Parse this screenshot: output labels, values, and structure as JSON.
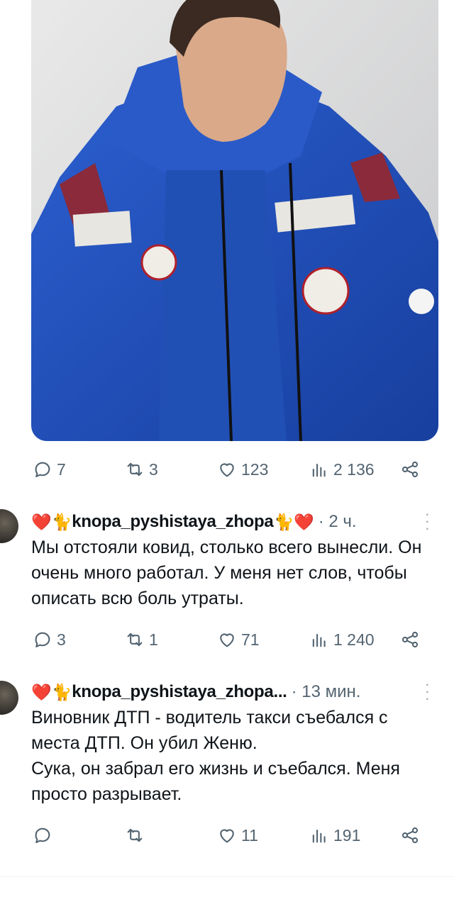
{
  "post": {
    "image_alt_icon": "photo",
    "stats": {
      "replies": "7",
      "reposts": "3",
      "likes": "123",
      "views": "2 136"
    }
  },
  "replies": [
    {
      "emoji_left": "❤️🐈",
      "username": "knopa_pyshistaya_zhopa",
      "emoji_right": "🐈❤️",
      "time": "· 2 ч.",
      "text": "Мы отстояли ковид, столько всего вынесли. Он очень много работал. У меня нет слов, чтобы описать всю боль утраты.",
      "stats": {
        "replies": "3",
        "reposts": "1",
        "likes": "71",
        "views": "1 240"
      }
    },
    {
      "emoji_left": "❤️🐈",
      "username": "knopa_pyshistaya_zhopa...",
      "emoji_right": "",
      "time": "· 13 мин.",
      "text": "Виновник ДТП - водитель такси съебался с места ДТП. Он убил Женю.\nСука, он забрал его жизнь и съебался. Меня просто разрывает.",
      "stats": {
        "replies": "",
        "reposts": "",
        "likes": "11",
        "views": "191"
      }
    }
  ],
  "colors": {
    "text": "#0f1419",
    "muted": "#536471",
    "jacket": "#1f4fb8",
    "heart": "#e0245e"
  }
}
